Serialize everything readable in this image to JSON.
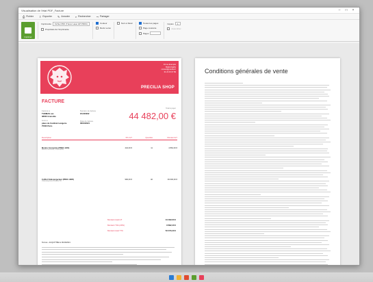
{
  "window": {
    "title": "Visualisation de l'état PDF_Facture",
    "controls": [
      "–",
      "□",
      "×"
    ]
  },
  "tabs": [
    {
      "icon": "print-icon",
      "glyph": "⎙",
      "label": "Fichier"
    },
    {
      "icon": "export-icon",
      "glyph": "⇪",
      "label": "Exporter"
    },
    {
      "icon": "annotate-icon",
      "glyph": "✎",
      "label": "Annoter"
    },
    {
      "icon": "search-icon",
      "glyph": "⌕",
      "label": "Rechercher"
    },
    {
      "icon": "share-icon",
      "glyph": "⤳",
      "label": "Partager"
    }
  ],
  "ribbon": {
    "big_button": "Imprimer",
    "printer_label": "Imprimante",
    "printer_value": "Fichier PDF (Tracer Laser HP PROC)",
    "printer_props": "Propriétés de l'imprimante",
    "options": [
      {
        "label": "Couleur",
        "checked": true
      },
      {
        "label": "Recto verso",
        "checked": false
      }
    ],
    "opt2": [
      {
        "label": "Noir et blanc",
        "checked": false
      }
    ],
    "pages": [
      {
        "label": "Toutes les pages",
        "checked": true
      },
      {
        "label": "Page courante",
        "checked": false
      },
      {
        "label": "Pages",
        "checked": false
      }
    ],
    "copies_label": "Copies",
    "copies_value": "1",
    "collate_label": "Assembler"
  },
  "invoice": {
    "band_info": [
      "34 rue Exemple",
      "75000 PARIS",
      "contact@precilia.fr",
      "01 23 45 67 89"
    ],
    "shop_name": "PRECILIA SHOP",
    "facture_label": "FACTURE",
    "client_label": "Facturé à",
    "client_name": "THOMAS sas",
    "client_city": "38000 Grenoble",
    "ship_label": "Livré à",
    "ship_address": "place du Cardinal Lavigerie",
    "ship_city": "75000 Paris",
    "number_label": "Numéro de facture",
    "number": "FAC00002",
    "date_label": "Date de facture",
    "date": "06/10/2021",
    "total_label": "Total à payer",
    "total": "44 482,00 €",
    "headers": [
      "Description",
      "Prix HT",
      "Quantité",
      "Montant HT"
    ],
    "rows": [
      {
        "desc": "Montre Connectée (PREC-1234)",
        "sub": "Montre connectée, écran tactile",
        "price": "442,00 €",
        "qty": "11",
        "amount": "4 862,00 €"
      },
      {
        "desc": "Coffret Vidéoprojecteur (PREC-4895)",
        "sub": "Vidéoprojecteur portable HD",
        "price": "990,00 €",
        "qty": "40",
        "amount": "39 600,00 €"
      }
    ],
    "totals": [
      {
        "label": "Montant total HT",
        "value": "44 462,00 €"
      },
      {
        "label": "Montant TVA (20%)",
        "value": "8 892,40 €"
      },
      {
        "label": "Montant total TTC",
        "value": "53 370,40 €"
      }
    ],
    "note": "Termes : ACQUITTÉE le 06/10/2021"
  },
  "cgv": {
    "title": "Conditions générales de vente"
  }
}
